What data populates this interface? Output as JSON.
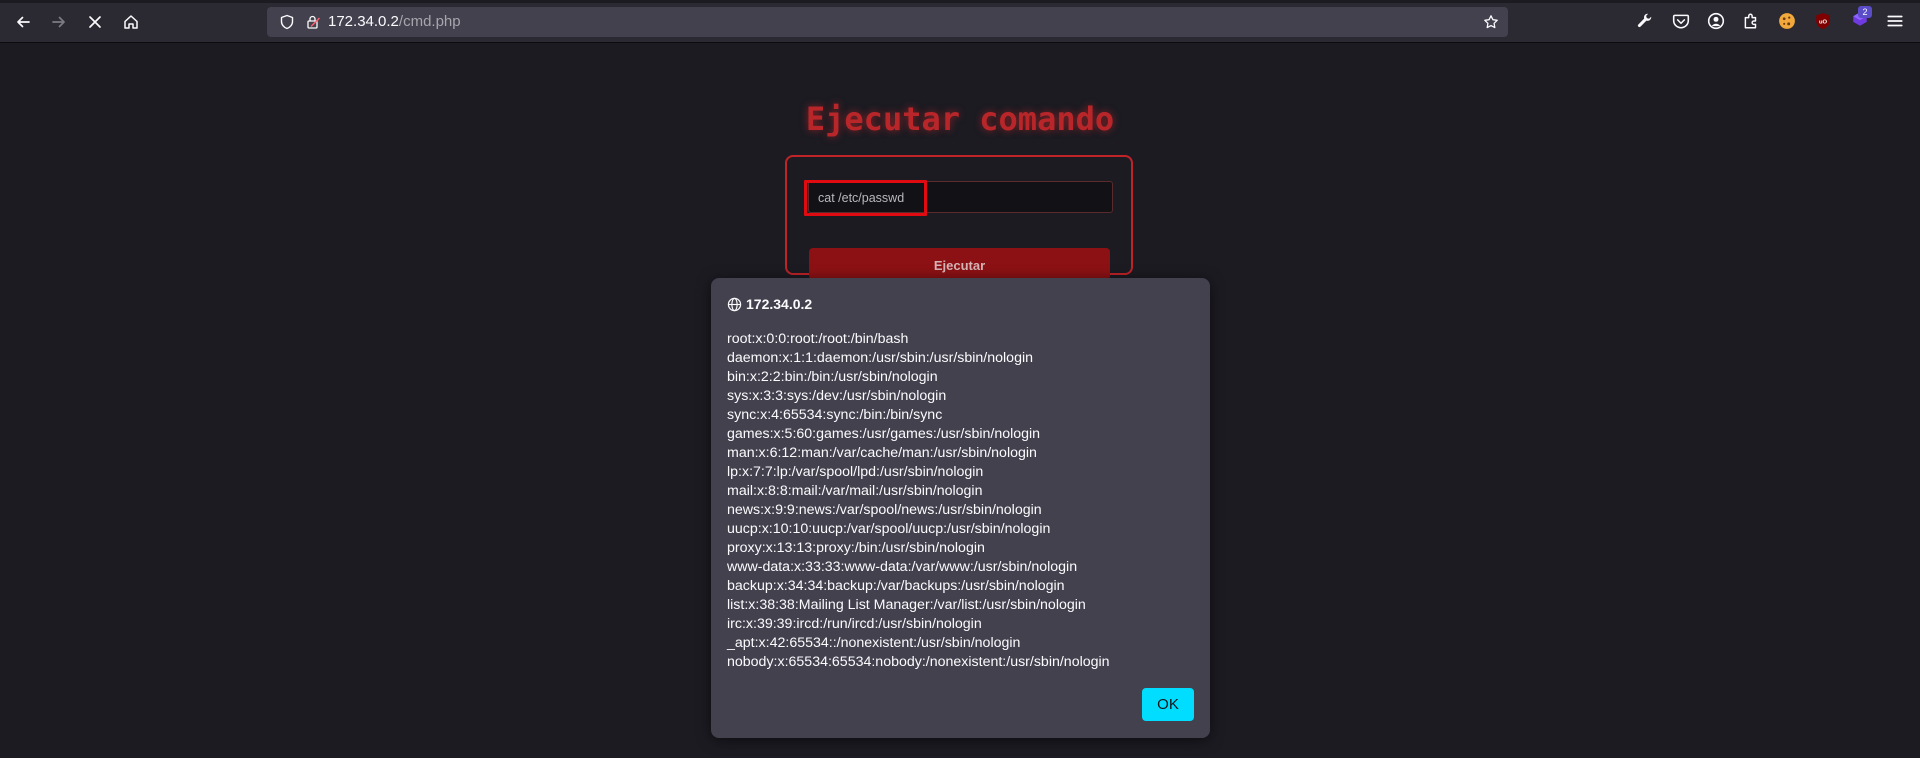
{
  "browser": {
    "url_host": "172.34.0.2",
    "url_path": "/cmd.php",
    "extension_badge": "2",
    "icons": {
      "back": "back-arrow-icon",
      "forward": "forward-arrow-icon",
      "stop": "stop-loading-icon",
      "home": "home-icon",
      "tracking": "tracking-protection-shield-icon",
      "insecure": "insecure-lock-icon",
      "bookmark": "bookmark-star-icon",
      "tools": "wrench-icon",
      "pocket": "pocket-icon",
      "account": "account-icon",
      "extensions": "extensions-puzzle-icon",
      "cookie": "cookie-extension-icon",
      "ublock": "ublock-origin-icon",
      "extension_purple": "purple-extension-icon",
      "menu": "hamburger-menu-icon"
    }
  },
  "page": {
    "title": "Ejecutar comando",
    "command_value": "cat /etc/passwd",
    "run_button_label": "Ejecutar"
  },
  "alert": {
    "origin": "172.34.0.2",
    "lines": [
      "root:x:0:0:root:/root:/bin/bash",
      "daemon:x:1:1:daemon:/usr/sbin:/usr/sbin/nologin",
      "bin:x:2:2:bin:/bin:/usr/sbin/nologin",
      "sys:x:3:3:sys:/dev:/usr/sbin/nologin",
      "sync:x:4:65534:sync:/bin:/bin/sync",
      "games:x:5:60:games:/usr/games:/usr/sbin/nologin",
      "man:x:6:12:man:/var/cache/man:/usr/sbin/nologin",
      "lp:x:7:7:lp:/var/spool/lpd:/usr/sbin/nologin",
      "mail:x:8:8:mail:/var/mail:/usr/sbin/nologin",
      "news:x:9:9:news:/var/spool/news:/usr/sbin/nologin",
      "uucp:x:10:10:uucp:/var/spool/uucp:/usr/sbin/nologin",
      "proxy:x:13:13:proxy:/bin:/usr/sbin/nologin",
      "www-data:x:33:33:www-data:/var/www:/usr/sbin/nologin",
      "backup:x:34:34:backup:/var/backups:/usr/sbin/nologin",
      "list:x:38:38:Mailing List Manager:/var/list:/usr/sbin/nologin",
      "irc:x:39:39:ircd:/run/ircd:/usr/sbin/nologin",
      "_apt:x:42:65534::/nonexistent:/usr/sbin/nologin",
      "nobody:x:65534:65534:nobody:/nonexistent:/usr/sbin/nologin"
    ],
    "ok_label": "OK"
  },
  "colors": {
    "background": "#1c1b22",
    "accent_red": "#c02328",
    "ok_button": "#00ddff",
    "dialog": "#42414d"
  }
}
